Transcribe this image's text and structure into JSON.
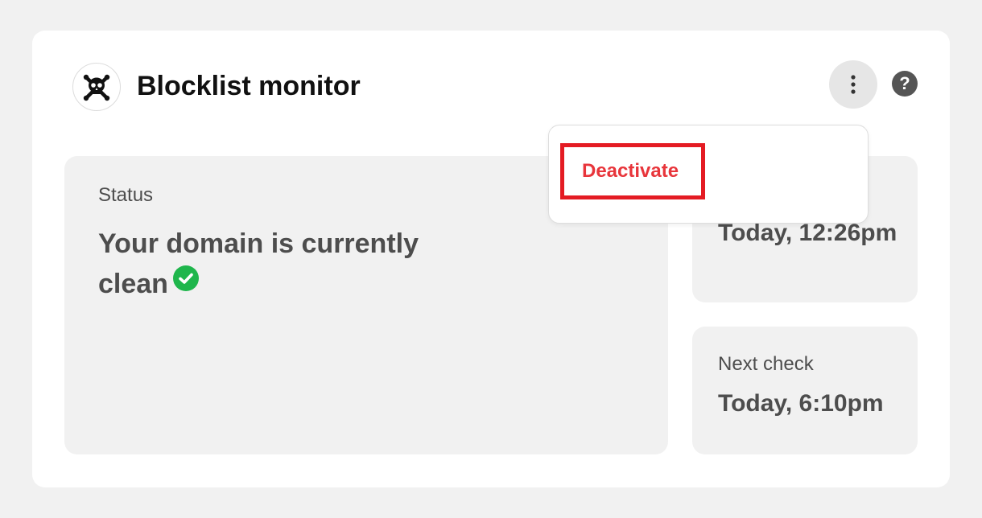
{
  "header": {
    "title": "Blocklist monitor",
    "logo_icon": "skull-crossbones-icon",
    "more_icon": "kebab-vertical-icon",
    "help_label": "?"
  },
  "menu": {
    "items": [
      {
        "label": "Deactivate",
        "color": "#e8353b"
      }
    ]
  },
  "status": {
    "label": "Status",
    "message": "Your domain is currently clean",
    "icon": "check-circle-icon",
    "icon_color": "#1fb64c"
  },
  "last_check": {
    "value": "Today, 12:26pm"
  },
  "next_check": {
    "label": "Next check",
    "value": "Today, 6:10pm"
  }
}
